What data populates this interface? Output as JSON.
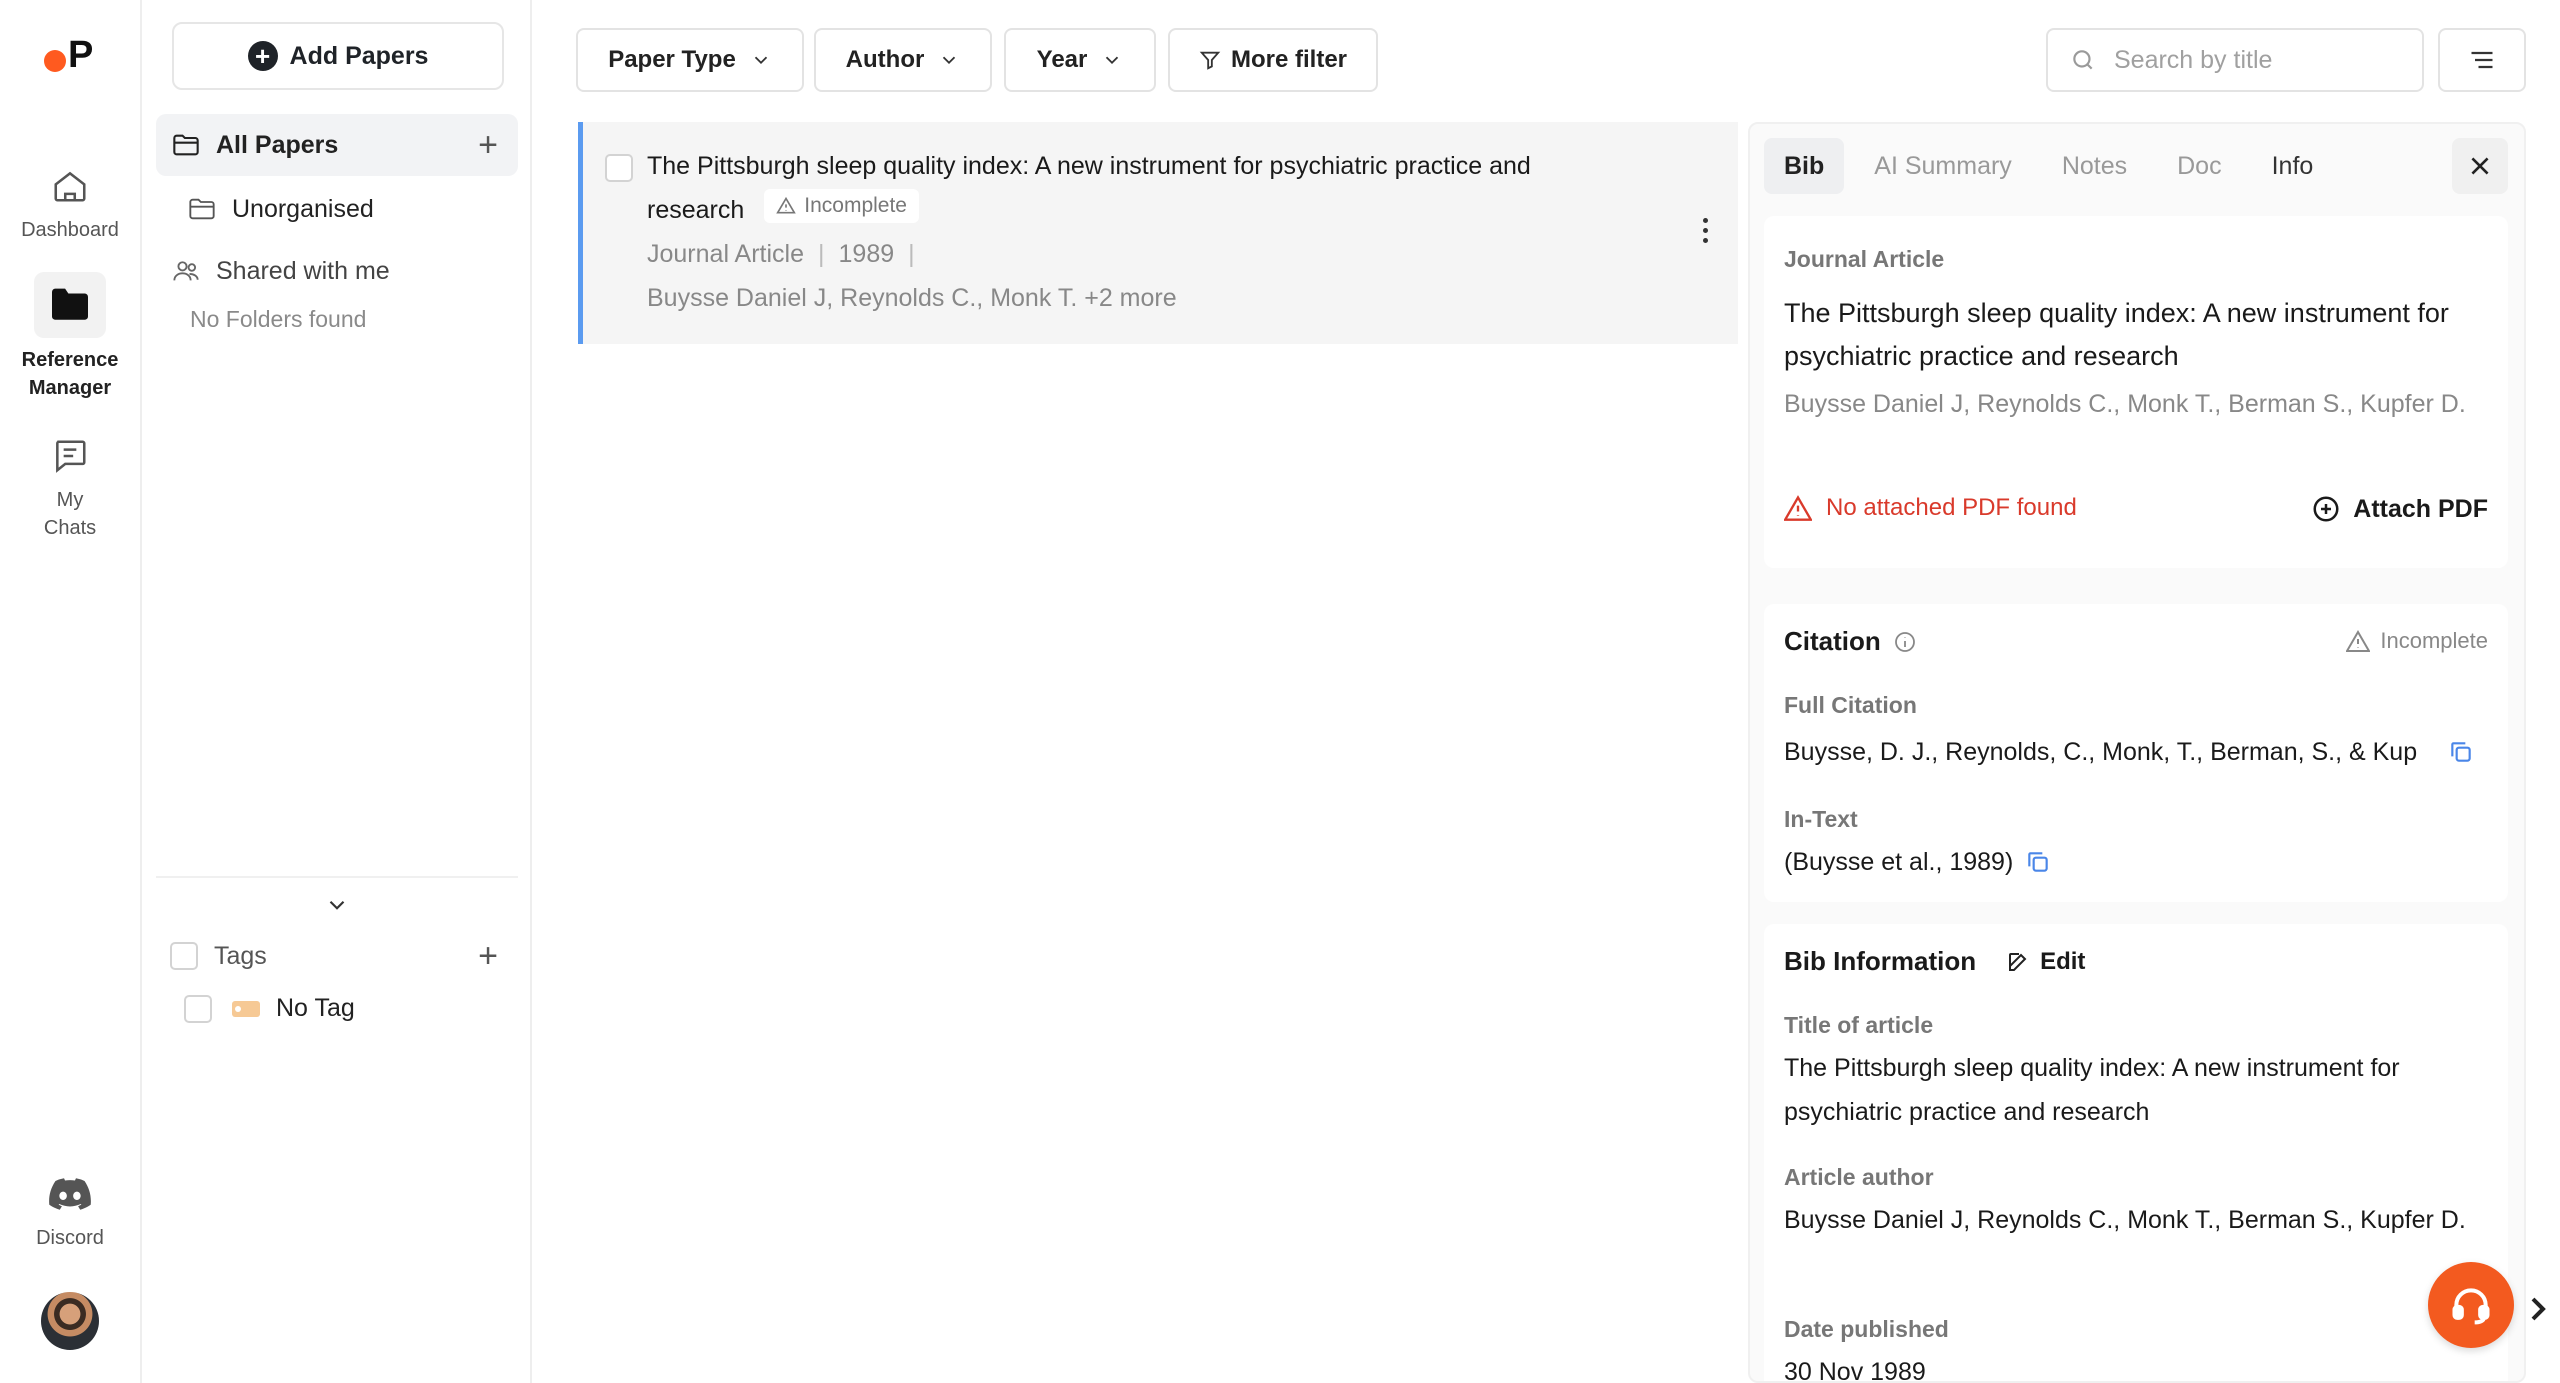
{
  "app": {
    "logo_letter": "P"
  },
  "rail": {
    "items": [
      {
        "label": "Dashboard"
      },
      {
        "label_line1": "Reference",
        "label_line2": "Manager"
      },
      {
        "label_line1": "My",
        "label_line2": "Chats"
      }
    ],
    "discord_label": "Discord"
  },
  "sidebar": {
    "add_papers_label": "Add Papers",
    "all_papers_label": "All Papers",
    "unorganised_label": "Unorganised",
    "shared_label": "Shared with me",
    "no_folders_label": "No Folders found",
    "tags_label": "Tags",
    "no_tag_label": "No Tag"
  },
  "toolbar": {
    "filters": [
      "Paper Type",
      "Author",
      "Year",
      "More filter"
    ],
    "search_placeholder": "Search by title"
  },
  "paper": {
    "title": "The Pittsburgh sleep quality index: A new instrument for psychiatric practice and research",
    "status_badge": "Incomplete",
    "type": "Journal Article",
    "year": "1989",
    "separator": "|",
    "authors": "Buysse Daniel J, Reynolds C., Monk T. +2 more"
  },
  "detail": {
    "tabs": [
      "Bib",
      "AI Summary",
      "Notes",
      "Doc",
      "Info"
    ],
    "active_tab": "Bib",
    "type": "Journal Article",
    "title": "The Pittsburgh sleep quality index: A new instrument for psychiatric practice and research",
    "authors": "Buysse Daniel J, Reynolds C., Monk T., Berman S., Kupfer D.",
    "no_pdf_label": "No attached PDF found",
    "attach_label": "Attach PDF",
    "citation": {
      "heading": "Citation",
      "status": "Incomplete",
      "full_label": "Full Citation",
      "full_value": "Buysse, D. J., Reynolds, C., Monk, T., Berman, S., & Kup",
      "intext_label": "In-Text",
      "intext_value": "(Buysse et al., 1989)"
    },
    "bib": {
      "heading": "Bib Information",
      "edit_label": "Edit",
      "title_label": "Title of article",
      "title_value": "The Pittsburgh sleep quality index: A new instrument for psychiatric practice and research",
      "author_label": "Article author",
      "author_value": "Buysse Daniel J, Reynolds C., Monk T., Berman S., Kupfer D.",
      "date_label": "Date published",
      "date_value": "30 Nov 1989"
    }
  },
  "colors": {
    "accent": "#f35a1f",
    "selection_border": "#5b9bf0",
    "warning": "#d93a2b",
    "copy_icon": "#4a86e8"
  }
}
